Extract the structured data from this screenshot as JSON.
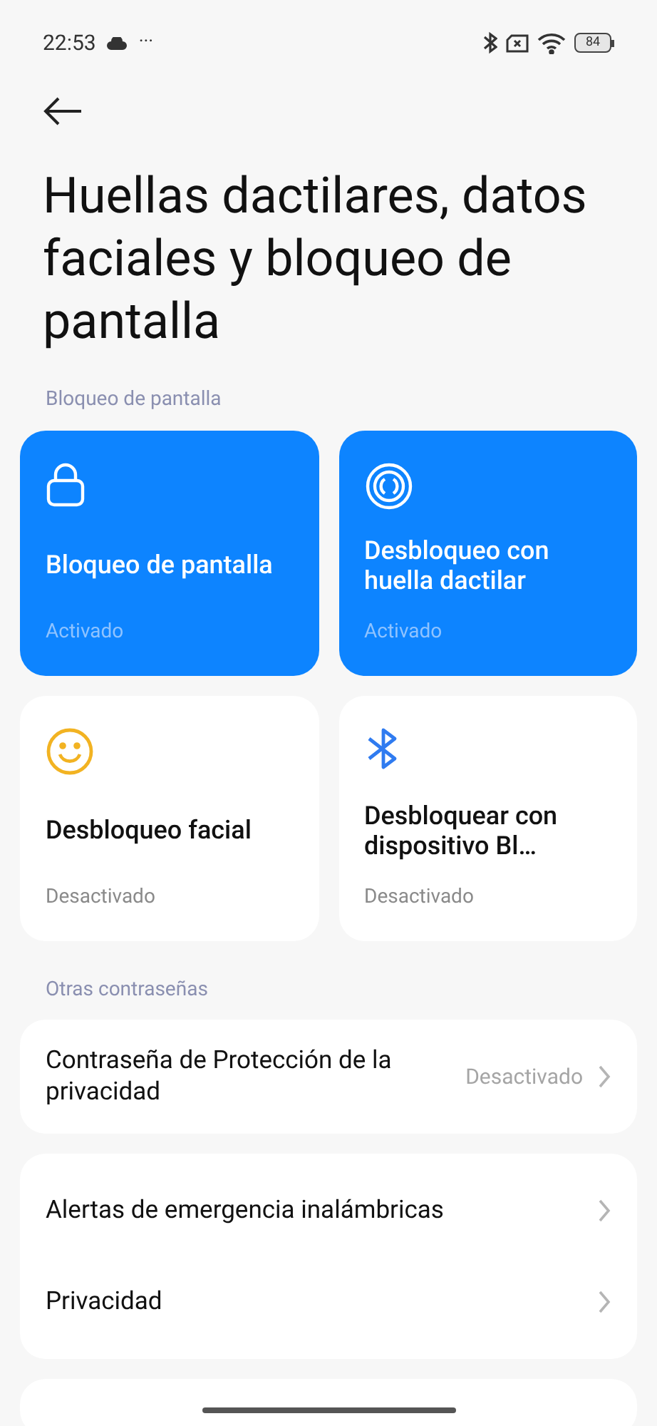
{
  "status_bar": {
    "time": "22:53",
    "more": "···",
    "battery": "84"
  },
  "title": "Huellas dactilares, datos faciales y bloqueo de pantalla",
  "sections": [
    {
      "header": "Bloqueo de pantalla",
      "tiles": [
        {
          "kind": "lock",
          "title": "Bloqueo de pantalla",
          "status": "Activado",
          "on": true
        },
        {
          "kind": "fingerprint",
          "title": "Desbloqueo con huella dactilar",
          "status": "Activado",
          "on": true
        },
        {
          "kind": "face",
          "title": "Desbloqueo facial",
          "status": "Desactivado",
          "on": false
        },
        {
          "kind": "bluetooth",
          "title": "Desbloquear con dispositivo Bl…",
          "status": "Desactivado",
          "on": false
        }
      ]
    },
    {
      "header": "Otras contraseñas",
      "groups": [
        [
          {
            "label": "Contraseña de Protección de la privacidad",
            "value": "Desactivado"
          }
        ],
        [
          {
            "label": "Alertas de emergencia inalámbricas"
          },
          {
            "label": "Privacidad"
          }
        ]
      ]
    }
  ]
}
